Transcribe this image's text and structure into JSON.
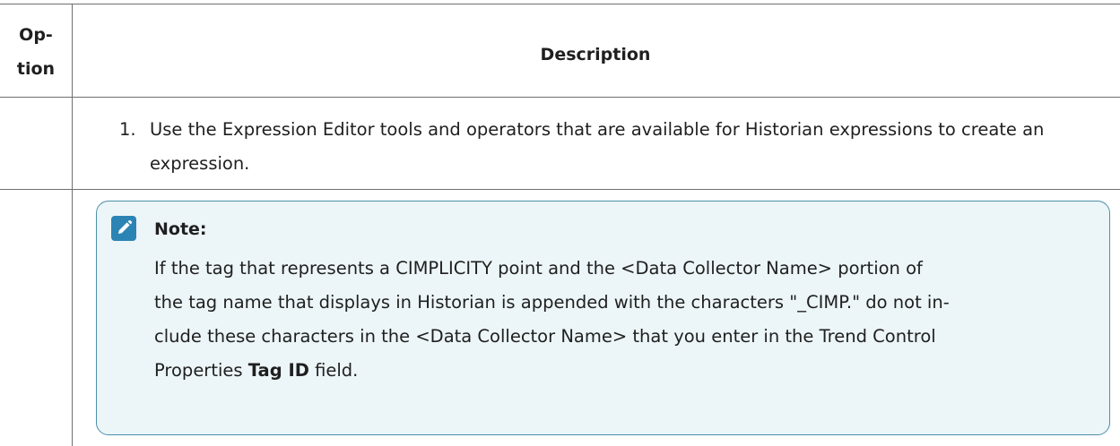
{
  "table": {
    "header": {
      "option_lines": [
        "Op-",
        "tion"
      ],
      "description": "Description"
    },
    "rows": [
      {
        "option": "",
        "step_number": "1.",
        "step_text": "Use the Expression Editor tools and operators that are available for Historian expressions to create an expression."
      }
    ]
  },
  "note": {
    "icon": "pencil-icon",
    "title": "Note:",
    "lines": [
      "If the tag that represents a CIMPLICITY point and the <Data Collector Name> portion of",
      "the tag name that displays in Historian is appended with the characters \"_CIMP.\" do not in-",
      "clude these characters in the <Data Collector Name> that you enter in the Trend Control"
    ],
    "last_line_prefix": "Properties ",
    "last_line_bold": "Tag ID",
    "last_line_suffix": " field."
  },
  "colors": {
    "note_border": "#4b8fa8",
    "note_background": "#ecf5f8",
    "icon_background": "#2b84b4",
    "table_border": "#6f6f6f"
  }
}
